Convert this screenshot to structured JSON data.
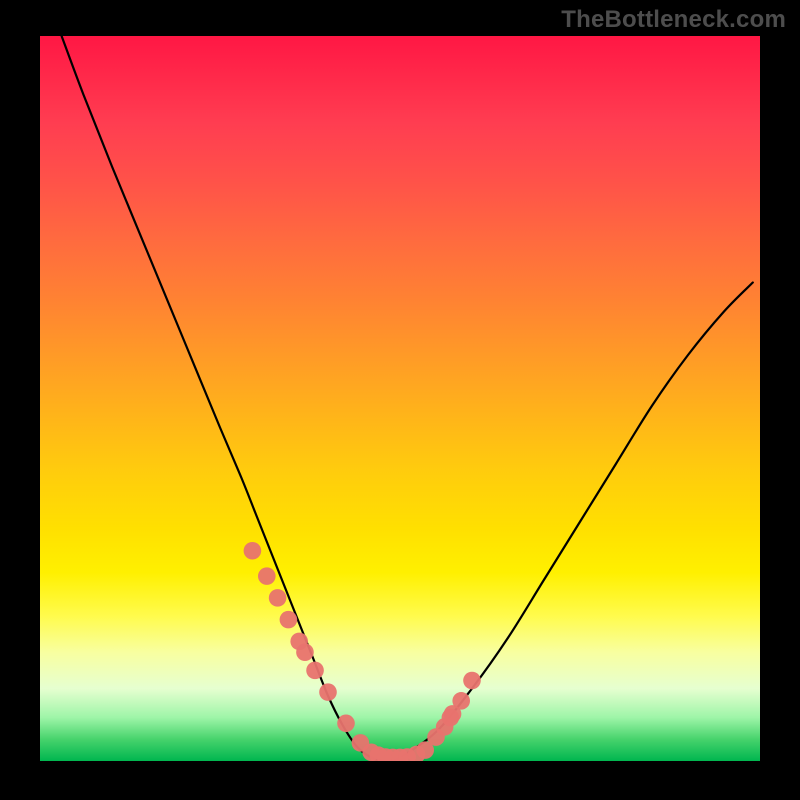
{
  "watermark": "TheBottleneck.com",
  "chart_data": {
    "type": "line",
    "title": "",
    "xlabel": "",
    "ylabel": "",
    "xlim": [
      0,
      100
    ],
    "ylim": [
      0,
      100
    ],
    "grid": false,
    "series": [
      {
        "name": "curve",
        "x": [
          3,
          6,
          10,
          15,
          20,
          25,
          28,
          30,
          32,
          34,
          36,
          38,
          40,
          42,
          44,
          46,
          48,
          50,
          55,
          60,
          65,
          70,
          75,
          80,
          85,
          90,
          95,
          99
        ],
        "y": [
          100,
          92,
          82,
          70,
          58,
          46,
          39,
          34,
          29,
          24,
          19,
          14,
          9,
          5,
          2,
          0.5,
          0,
          0.5,
          4,
          10,
          17,
          25,
          33,
          41,
          49,
          56,
          62,
          66
        ]
      }
    ],
    "markers": {
      "name": "dots",
      "x": [
        29.5,
        31.5,
        33,
        34.5,
        36,
        36.8,
        38.2,
        40,
        42.5,
        44.5,
        46,
        47,
        48,
        49,
        50,
        51,
        52.3,
        53.5,
        55,
        56.2,
        57,
        57.3,
        58.5,
        60
      ],
      "y": [
        29,
        25.5,
        22.5,
        19.5,
        16.5,
        15,
        12.5,
        9.5,
        5.2,
        2.5,
        1.2,
        0.8,
        0.55,
        0.5,
        0.5,
        0.55,
        0.9,
        1.5,
        3.3,
        4.7,
        6.0,
        6.5,
        8.3,
        11.1
      ]
    },
    "gradient_colors": {
      "top": "#ff1744",
      "mid": "#ffe000",
      "bottom": "#00b64f"
    },
    "plot_background": "gradient-red-to-green",
    "frame_color": "#000000"
  }
}
